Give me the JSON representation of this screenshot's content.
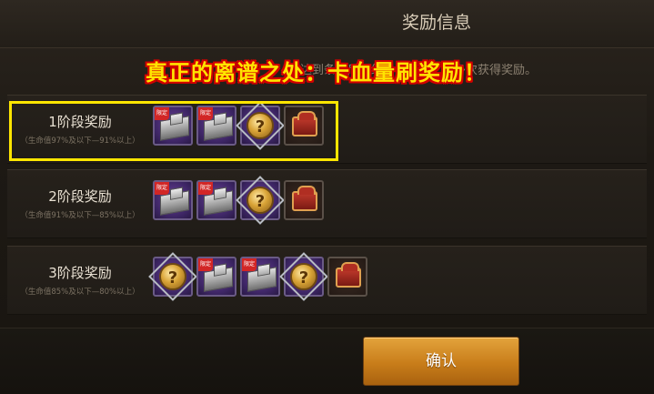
{
  "dialog": {
    "title": "奖励信息",
    "hint": "达到条件后系统自动发放，可多次获得奖励。",
    "caption": "真正的离谱之处：卡血量刷奖励！",
    "confirm_label": "确认"
  },
  "tiers": [
    {
      "name": "1阶段奖励",
      "condition": "（生命值97%及以下—91%以上）",
      "rewards": [
        "ticket-ribbon",
        "ticket-ribbon",
        "mystery-coin",
        "red-chest"
      ]
    },
    {
      "name": "2阶段奖励",
      "condition": "（生命值91%及以下—85%以上）",
      "rewards": [
        "ticket-ribbon",
        "ticket-ribbon",
        "mystery-coin",
        "red-chest"
      ]
    },
    {
      "name": "3阶段奖励",
      "condition": "（生命值85%及以下—80%以上）",
      "rewards": [
        "mystery-coin",
        "ticket-ribbon",
        "ticket-ribbon",
        "mystery-coin",
        "red-chest"
      ]
    }
  ],
  "ribbon_text": "限定",
  "coin_glyph": "?",
  "colors": {
    "highlight": "#ffe600",
    "caption_fill": "#ffe400",
    "caption_outline": "#d20000",
    "button": "#c87d1a"
  }
}
